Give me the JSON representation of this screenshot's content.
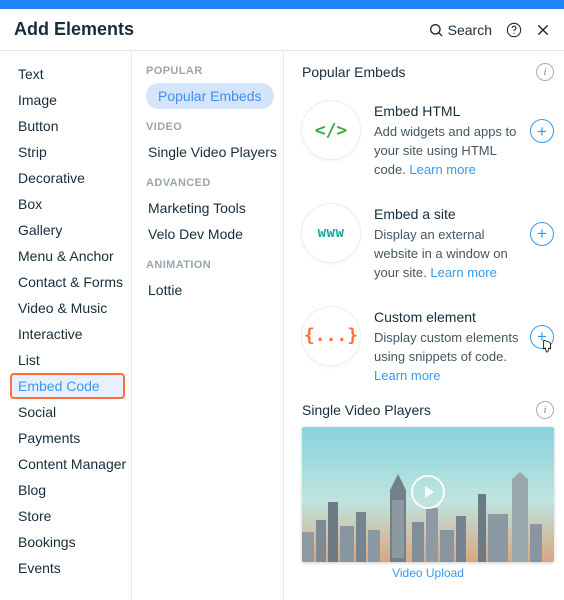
{
  "header": {
    "title": "Add Elements",
    "search_label": "Search",
    "help_title": "Help",
    "close_title": "Close"
  },
  "sidebar": {
    "items": [
      "Text",
      "Image",
      "Button",
      "Strip",
      "Decorative",
      "Box",
      "Gallery",
      "Menu & Anchor",
      "Contact & Forms",
      "Video & Music",
      "Interactive",
      "List",
      "Embed Code",
      "Social",
      "Payments",
      "Content Manager",
      "Blog",
      "Store",
      "Bookings",
      "Events"
    ],
    "selected_index": 12
  },
  "sub": {
    "groups": [
      {
        "header": "POPULAR",
        "items": [
          "Popular Embeds"
        ],
        "active_index": 0
      },
      {
        "header": "VIDEO",
        "items": [
          "Single Video Players"
        ]
      },
      {
        "header": "ADVANCED",
        "items": [
          "Marketing Tools",
          "Velo Dev Mode"
        ]
      },
      {
        "header": "ANIMATION",
        "items": [
          "Lottie"
        ]
      }
    ]
  },
  "main": {
    "embeds_title": "Popular Embeds",
    "embeds": [
      {
        "icon_glyph": "</>",
        "icon_class": "g-green",
        "title": "Embed HTML",
        "desc": "Add widgets and apps to your site using HTML code.",
        "learn": "Learn more"
      },
      {
        "icon_glyph": "www",
        "icon_class": "g-teal",
        "title": "Embed a site",
        "desc": "Display an external website in a window on your site.",
        "learn": "Learn more"
      },
      {
        "icon_glyph": "{...}",
        "icon_class": "g-or",
        "title": "Custom element",
        "desc": "Display custom elements using snippets of code.",
        "learn": "Learn more",
        "cursor": true
      }
    ],
    "svp_title": "Single Video Players",
    "video_caption": "Video Upload"
  }
}
